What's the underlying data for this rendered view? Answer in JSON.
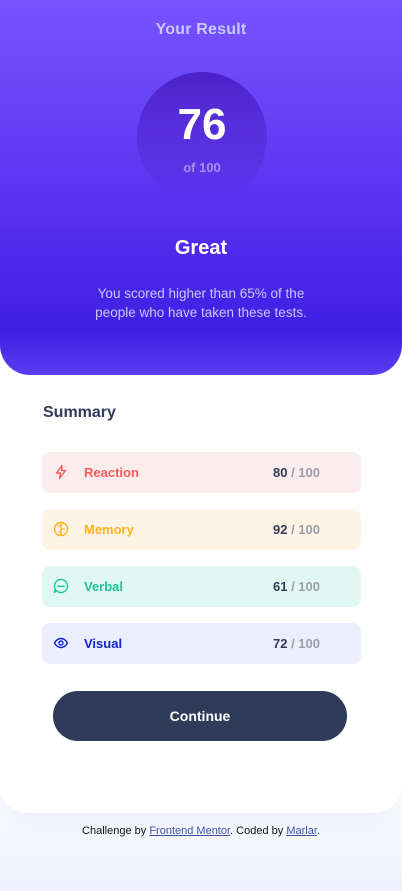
{
  "result": {
    "title": "Your Result",
    "score": "76",
    "score_max": "of 100",
    "rating": "Great",
    "description": "You scored higher than 65% of the people who have taken these tests."
  },
  "summary": {
    "title": "Summary",
    "items": [
      {
        "label": "Reaction",
        "score": "80",
        "max": " / 100",
        "color": "#f55d5d",
        "icon": "lightning-icon"
      },
      {
        "label": "Memory",
        "score": "92",
        "max": " / 100",
        "color": "#ffb21e",
        "icon": "brain-icon"
      },
      {
        "label": "Verbal",
        "score": "61",
        "max": " / 100",
        "color": "#1dc496",
        "icon": "speech-bubble-icon"
      },
      {
        "label": "Visual",
        "score": "72",
        "max": " / 100",
        "color": "#1125d4",
        "icon": "eye-icon"
      }
    ],
    "button_label": "Continue"
  },
  "attribution": {
    "prefix": "Challenge by ",
    "link1": "Frontend Mentor",
    "middle": ". Coded by ",
    "link2": "Marlar",
    "suffix": "."
  }
}
